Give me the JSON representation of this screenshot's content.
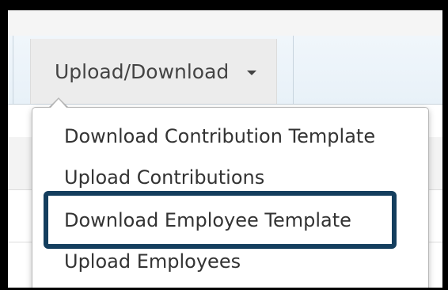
{
  "toolbar": {
    "upload_download_label": "Upload/Download",
    "caret_icon": "caret-down-icon"
  },
  "dropdown_menu": {
    "items": [
      {
        "label": "Download Contribution Template"
      },
      {
        "label": "Upload Contributions"
      },
      {
        "label": "Download Employee Template",
        "highlighted": true
      },
      {
        "label": "Upload Employees"
      }
    ]
  },
  "colors": {
    "highlight_border": "#143e5e",
    "frame": "#000000",
    "text": "#333333"
  }
}
